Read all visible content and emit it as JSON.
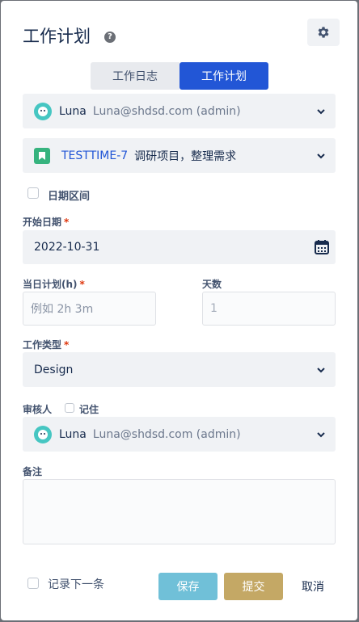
{
  "dialog": {
    "title": "工作计划"
  },
  "tabs": [
    {
      "label": "工作日志"
    },
    {
      "label": "工作计划"
    }
  ],
  "user": {
    "name": "Luna",
    "email": "Luna@shdsd.com (admin)"
  },
  "issue": {
    "key": "TESTTIME-7",
    "summary": "调研项目，整理需求"
  },
  "date_range": {
    "label": "日期区间"
  },
  "start_date": {
    "label": "开始日期",
    "value": "2022-10-31"
  },
  "daily_plan": {
    "label": "当日计划(h)",
    "placeholder": "例如 2h 3m"
  },
  "days": {
    "label": "天数",
    "placeholder": "1"
  },
  "work_type": {
    "label": "工作类型",
    "value": "Design"
  },
  "reviewer": {
    "label": "审核人",
    "remember_label": "记住",
    "name": "Luna",
    "email": "Luna@shdsd.com (admin)"
  },
  "note": {
    "label": "备注"
  },
  "footer": {
    "record_next_label": "记录下一条",
    "save_label": "保存",
    "submit_label": "提交",
    "cancel_label": "取消"
  },
  "colors": {
    "primary": "#2256d6",
    "save": "#70c0d8",
    "submit": "#c4a865",
    "required": "#de350b"
  }
}
